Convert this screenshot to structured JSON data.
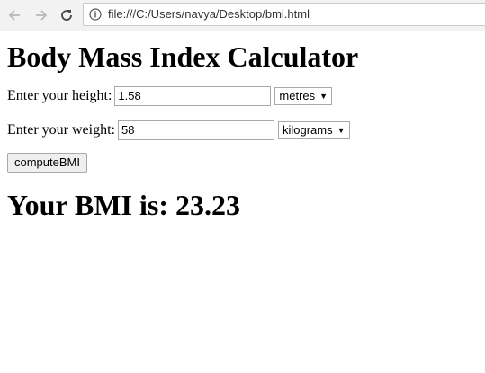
{
  "browser": {
    "url": "file:///C:/Users/navya/Desktop/bmi.html"
  },
  "page": {
    "title": "Body Mass Index Calculator",
    "height_label": "Enter your height:",
    "height_value": "1.58",
    "height_unit": "metres",
    "weight_label": "Enter your weight:",
    "weight_value": "58",
    "weight_unit": "kilograms",
    "compute_label": "computeBMI",
    "result_text": "Your BMI is: 23.23"
  }
}
